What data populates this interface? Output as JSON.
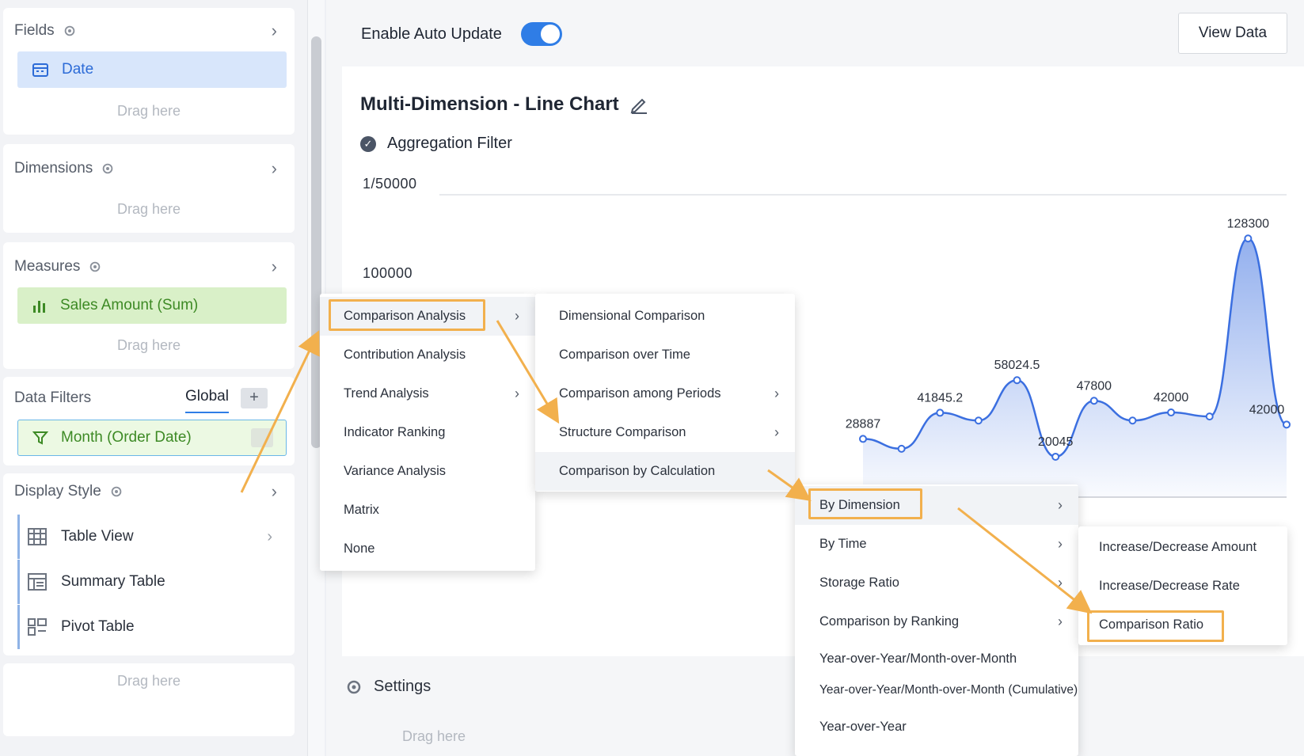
{
  "left_panel": {
    "fields": {
      "title": "Fields",
      "item": "Date",
      "drag": "Drag here"
    },
    "dimensions": {
      "title": "Dimensions",
      "drag": "Drag here"
    },
    "measures": {
      "title": "Measures",
      "item": "Sales Amount (Sum)",
      "drag": "Drag here"
    },
    "data_filters": {
      "title": "Data Filters",
      "tab": "Global",
      "item": "Month (Order Date)"
    },
    "display_style": {
      "title": "Display Style",
      "items": [
        "Table View",
        "Summary Table",
        "Pivot Table"
      ],
      "drag": "Drag here"
    }
  },
  "toolbar": {
    "auto_update_label": "Enable Auto Update",
    "auto_update_on": true,
    "view_data_label": "View Data"
  },
  "chart_header": {
    "title": "Multi-Dimension - Line Chart",
    "aggregation_filter": "Aggregation Filter"
  },
  "settings": {
    "label": "Settings",
    "drag": "Drag here"
  },
  "chart_data": {
    "type": "area",
    "y_tick_labels": [
      "1/50000",
      "100000"
    ],
    "data_labels": [
      "28887",
      "41845.2",
      "58024.5",
      "20045",
      "47800",
      "42000",
      "128300",
      "42000"
    ],
    "series": [
      {
        "values": [
          28887,
          24000,
          41845.2,
          38000,
          58024.5,
          20045,
          47800,
          38000,
          42000,
          40000,
          128300,
          36000
        ]
      }
    ],
    "ylim": [
      0,
      150000
    ],
    "color": "#3b6fe0"
  },
  "menus": {
    "analysis": {
      "items": [
        {
          "label": "Comparison Analysis",
          "submenu": true
        },
        {
          "label": "Contribution Analysis",
          "submenu": false
        },
        {
          "label": "Trend Analysis",
          "submenu": true
        },
        {
          "label": "Indicator Ranking",
          "submenu": false
        },
        {
          "label": "Variance Analysis",
          "submenu": false
        },
        {
          "label": "Matrix",
          "submenu": false
        },
        {
          "label": "None",
          "submenu": false
        }
      ]
    },
    "comparison": {
      "items": [
        {
          "label": "Dimensional Comparison",
          "submenu": false
        },
        {
          "label": "Comparison over Time",
          "submenu": false
        },
        {
          "label": "Comparison among Periods",
          "submenu": true
        },
        {
          "label": "Structure Comparison",
          "submenu": true
        },
        {
          "label": "Comparison by Calculation",
          "submenu": false
        }
      ]
    },
    "calculation": {
      "items": [
        {
          "label": "By Dimension",
          "submenu": true
        },
        {
          "label": "By Time",
          "submenu": true
        },
        {
          "label": "Storage Ratio",
          "submenu": true
        },
        {
          "label": "Comparison by Ranking",
          "submenu": true
        },
        {
          "label": "Year-over-Year/Month-over-Month",
          "submenu": false
        },
        {
          "label": "Year-over-Year/Month-over-Month (Cumulative)",
          "submenu": false
        },
        {
          "label": "Year-over-Year",
          "submenu": false
        }
      ]
    },
    "dimension": {
      "items": [
        {
          "label": "Increase/Decrease Amount"
        },
        {
          "label": "Increase/Decrease Rate"
        },
        {
          "label": "Comparison Ratio"
        }
      ]
    }
  },
  "colors": {
    "accent": "#2f7de6",
    "highlight": "#f2b04d",
    "measure": "#3d8a25"
  }
}
